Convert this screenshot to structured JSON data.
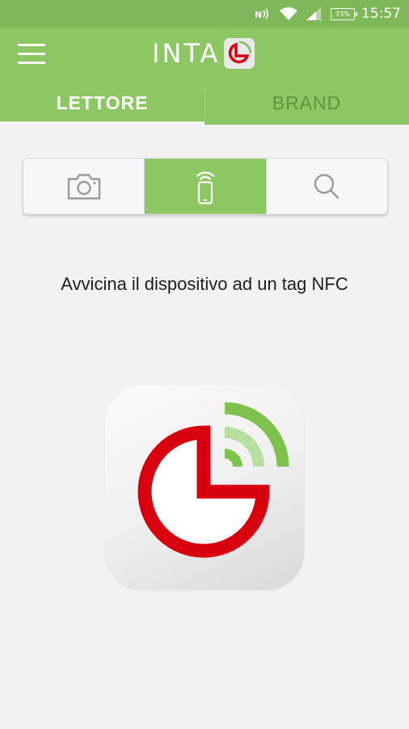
{
  "status_bar": {
    "time": "15:57",
    "battery_label": "73%",
    "icons": [
      "nfc-icon",
      "wifi-icon",
      "signal-icon",
      "battery-icon"
    ]
  },
  "app_bar": {
    "logo_text": "INTA",
    "menu_icon": "hamburger-menu-icon"
  },
  "tabs": [
    {
      "label": "LETTORE",
      "active": true
    },
    {
      "label": "BRAND",
      "active": false
    }
  ],
  "reader_modes": [
    {
      "icon": "camera-icon",
      "active": false
    },
    {
      "icon": "nfc-phone-icon",
      "active": true
    },
    {
      "icon": "search-icon",
      "active": false
    }
  ],
  "main": {
    "hint_text": "Avvicina il dispositivo ad un tag NFC"
  },
  "colors": {
    "status_bar": "#7fb858",
    "app_bar": "#8cc763",
    "inactive_tab": "#5f9440",
    "logo_red": "#d8000f",
    "logo_green": "#7ec24e"
  }
}
